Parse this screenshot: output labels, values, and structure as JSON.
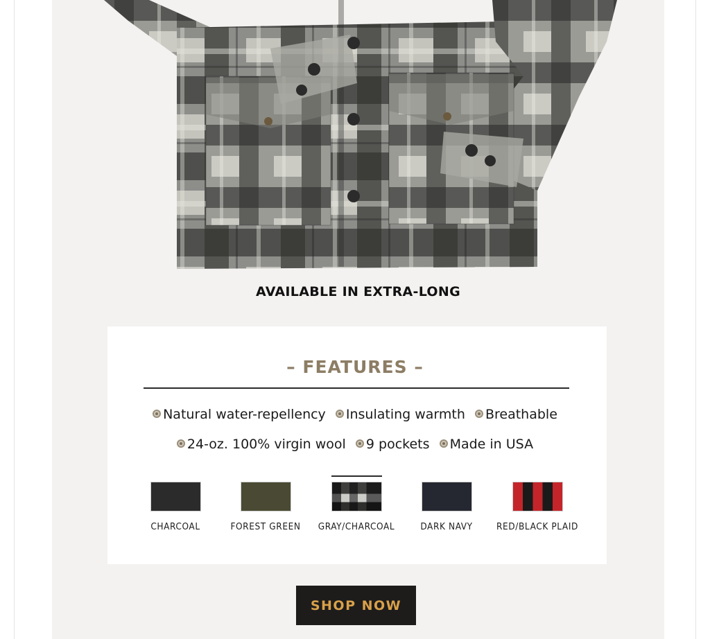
{
  "headline": "AVAILABLE IN EXTRA-LONG",
  "features": {
    "title": "– FEATURES –",
    "row1": [
      "Natural water-repellency",
      "Insulating warmth",
      "Breathable"
    ],
    "row2": [
      "24-oz. 100% virgin wool",
      "9 pockets",
      "Made in USA"
    ]
  },
  "colors": [
    {
      "label": "CHARCOAL",
      "color": "#2b2b2b",
      "selected": false
    },
    {
      "label": "FOREST GREEN",
      "color": "#4a4a34",
      "selected": false
    },
    {
      "label": "GRAY/CHARCOAL",
      "color": "#8a8a88",
      "selected": true
    },
    {
      "label": "DARK NAVY",
      "color": "#262831",
      "selected": false
    },
    {
      "label": "RED/BLACK PLAID",
      "color": "#c4252a",
      "selected": false
    }
  ],
  "cta": {
    "label": "SHOP NOW"
  },
  "palette": {
    "accent": "#8c7d64",
    "button_bg": "#1d1c1b",
    "button_text": "#d9a14a",
    "email_bg": "#f3f2f0"
  }
}
